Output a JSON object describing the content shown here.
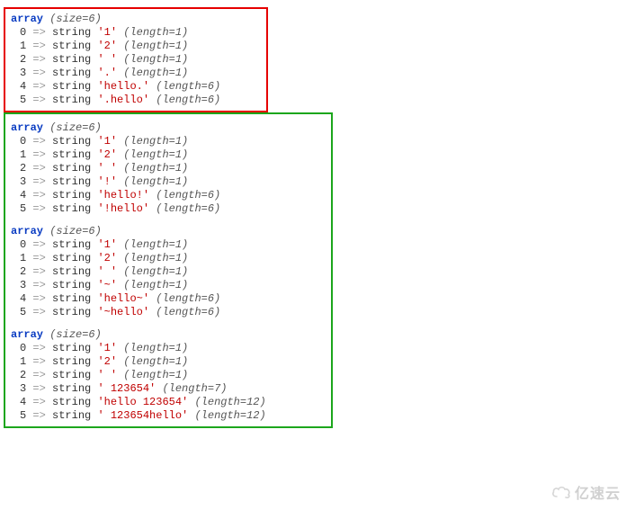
{
  "keyword": "array",
  "type_label": "string",
  "arrow": "=>",
  "size_prefix": "(size=",
  "size_suffix": ")",
  "length_prefix": "(length=",
  "length_suffix": ")",
  "red_block": {
    "size": 6,
    "items": [
      {
        "index": 0,
        "value": "'1'",
        "length": 1
      },
      {
        "index": 1,
        "value": "'2'",
        "length": 1
      },
      {
        "index": 2,
        "value": "' '",
        "length": 1
      },
      {
        "index": 3,
        "value": "'.'",
        "length": 1
      },
      {
        "index": 4,
        "value": "'hello.'",
        "length": 6
      },
      {
        "index": 5,
        "value": "'.hello'",
        "length": 6
      }
    ]
  },
  "green_blocks": [
    {
      "size": 6,
      "items": [
        {
          "index": 0,
          "value": "'1'",
          "length": 1
        },
        {
          "index": 1,
          "value": "'2'",
          "length": 1
        },
        {
          "index": 2,
          "value": "' '",
          "length": 1
        },
        {
          "index": 3,
          "value": "'!'",
          "length": 1
        },
        {
          "index": 4,
          "value": "'hello!'",
          "length": 6
        },
        {
          "index": 5,
          "value": "'!hello'",
          "length": 6
        }
      ]
    },
    {
      "size": 6,
      "items": [
        {
          "index": 0,
          "value": "'1'",
          "length": 1
        },
        {
          "index": 1,
          "value": "'2'",
          "length": 1
        },
        {
          "index": 2,
          "value": "' '",
          "length": 1
        },
        {
          "index": 3,
          "value": "'~'",
          "length": 1
        },
        {
          "index": 4,
          "value": "'hello~'",
          "length": 6
        },
        {
          "index": 5,
          "value": "'~hello'",
          "length": 6
        }
      ]
    },
    {
      "size": 6,
      "items": [
        {
          "index": 0,
          "value": "'1'",
          "length": 1
        },
        {
          "index": 1,
          "value": "'2'",
          "length": 1
        },
        {
          "index": 2,
          "value": "' '",
          "length": 1
        },
        {
          "index": 3,
          "value": "' 123654'",
          "length": 7
        },
        {
          "index": 4,
          "value": "'hello 123654'",
          "length": 12
        },
        {
          "index": 5,
          "value": "' 123654hello'",
          "length": 12
        }
      ]
    }
  ],
  "watermark_text": "亿速云"
}
